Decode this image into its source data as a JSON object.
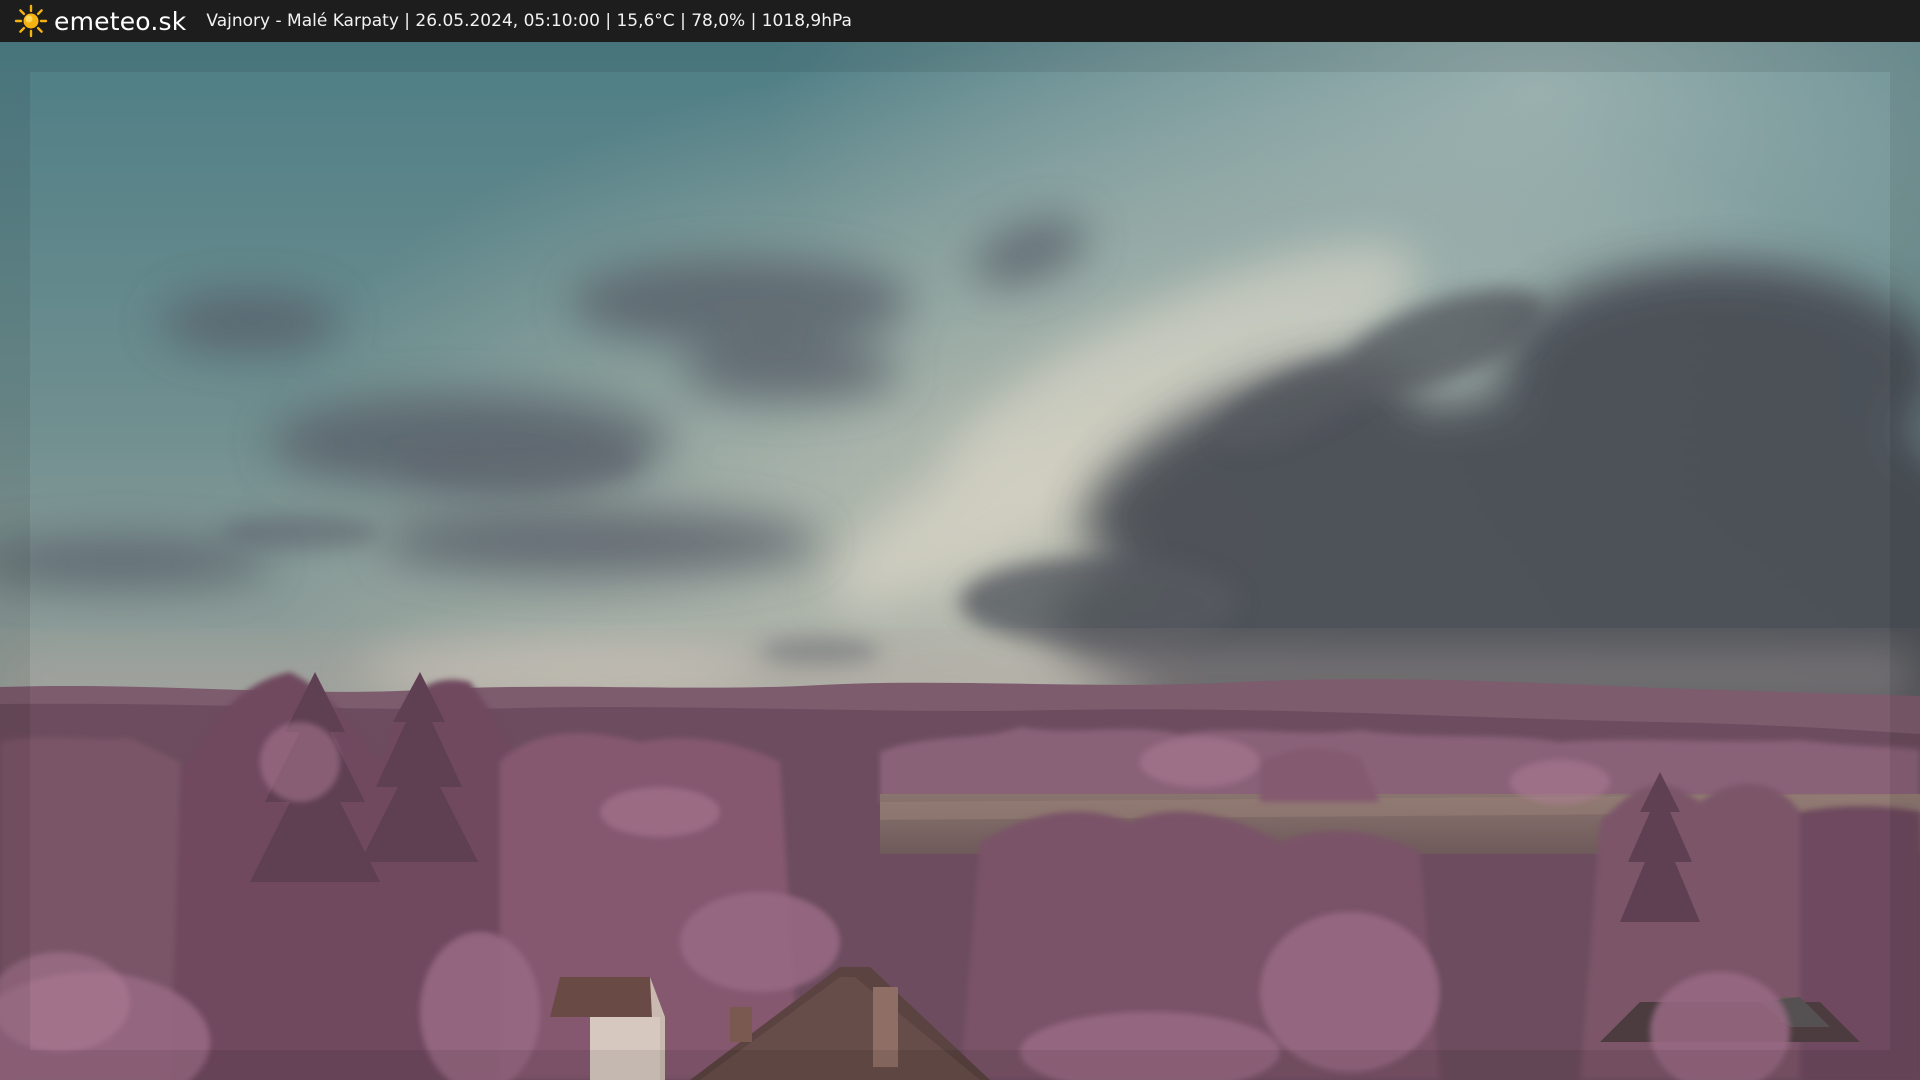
{
  "header": {
    "brand": "emeteo.sk",
    "brand_icon": "sun-icon",
    "info": "Vajnory - Malé Karpaty | 26.05.2024, 05:10:00 | 15,6°C | 78,0% | 1018,9hPa"
  },
  "colors": {
    "bar_background": "#1d1d1d",
    "sun_yellow": "#f5b312",
    "sky_top": "#4f7f86",
    "sky_horizon": "#b9a8a0",
    "vegetation": "#8c5f78"
  }
}
